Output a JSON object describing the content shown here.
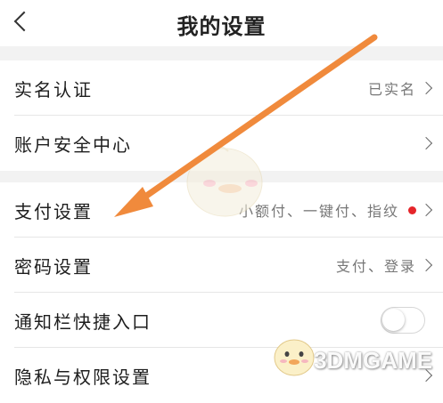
{
  "header": {
    "title": "我的设置"
  },
  "groups": [
    {
      "items": [
        {
          "label": "实名认证",
          "value": "已实名"
        },
        {
          "label": "账户安全中心",
          "value": ""
        }
      ]
    },
    {
      "items": [
        {
          "label": "支付设置",
          "value": "小额付、一键付、指纹"
        },
        {
          "label": "密码设置",
          "value": "支付、登录"
        },
        {
          "label": "通知栏快捷入口",
          "toggle_on": false
        },
        {
          "label": "隐私与权限设置"
        }
      ]
    }
  ],
  "annotation": {
    "arrow_color": "#f08a3c"
  },
  "watermark": {
    "text": "3DMGAME"
  },
  "colors": {
    "background": "#f2f2f2",
    "badge_red": "#e5252a"
  }
}
